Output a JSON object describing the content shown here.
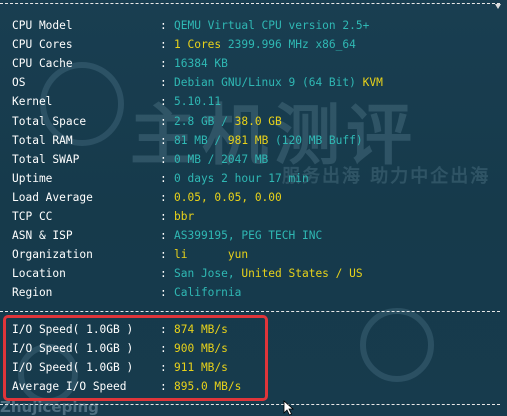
{
  "watermark": {
    "big_text": "主机测评",
    "small_text": "服务出海 助力中企出海",
    "bottom_text": "Zhujiceping"
  },
  "colors": {
    "background": "#173a4c",
    "label": "#ffffff",
    "value_cyan": "#2fb8b4",
    "value_yellow": "#e8d21a",
    "highlight_border": "#e0353a"
  },
  "rows": [
    {
      "label": "CPU Model",
      "parts": [
        {
          "text": "QEMU Virtual CPU version 2.5+",
          "color": "cyan"
        }
      ]
    },
    {
      "label": "CPU Cores",
      "parts": [
        {
          "text": "1 Cores ",
          "color": "yellow"
        },
        {
          "text": "2399.996 MHz x86_64",
          "color": "cyan"
        }
      ]
    },
    {
      "label": "CPU Cache",
      "parts": [
        {
          "text": "16384 KB",
          "color": "cyan"
        }
      ]
    },
    {
      "label": "OS",
      "parts": [
        {
          "text": "Debian GNU/Linux 9 (64 Bit) ",
          "color": "cyan"
        },
        {
          "text": "KVM",
          "color": "yellow"
        }
      ]
    },
    {
      "label": "Kernel",
      "parts": [
        {
          "text": "5.10.11",
          "color": "cyan"
        }
      ]
    },
    {
      "label": "Total Space",
      "parts": [
        {
          "text": "2.8 GB / ",
          "color": "cyan"
        },
        {
          "text": "38.0 GB",
          "color": "yellow"
        }
      ]
    },
    {
      "label": "Total RAM",
      "parts": [
        {
          "text": "81 MB / ",
          "color": "cyan"
        },
        {
          "text": "981 MB",
          "color": "yellow"
        },
        {
          "text": " (120 MB Buff)",
          "color": "cyan"
        }
      ]
    },
    {
      "label": "Total SWAP",
      "parts": [
        {
          "text": "0 MB / 2047 MB",
          "color": "cyan"
        }
      ]
    },
    {
      "label": "Uptime",
      "parts": [
        {
          "text": "0 days 2 hour 17 min",
          "color": "cyan"
        }
      ]
    },
    {
      "label": "Load Average",
      "parts": [
        {
          "text": "0.05, 0.05, 0.00",
          "color": "yellow"
        }
      ]
    },
    {
      "label": "TCP CC",
      "parts": [
        {
          "text": "bbr",
          "color": "yellow"
        }
      ]
    },
    {
      "label": "ASN & ISP",
      "parts": [
        {
          "text": "AS399195, PEG TECH INC",
          "color": "cyan"
        }
      ]
    },
    {
      "label": "Organization",
      "parts": [
        {
          "text": "li      yun",
          "color": "yellow"
        }
      ]
    },
    {
      "label": "Location",
      "parts": [
        {
          "text": "San Jose, ",
          "color": "cyan"
        },
        {
          "text": "United States / US",
          "color": "yellow"
        }
      ]
    },
    {
      "label": "Region",
      "parts": [
        {
          "text": "California",
          "color": "cyan"
        }
      ]
    }
  ],
  "io_rows": [
    {
      "label": "I/O Speed( 1.0GB )",
      "value": "874 MB/s"
    },
    {
      "label": "I/O Speed( 1.0GB )",
      "value": "900 MB/s"
    },
    {
      "label": "I/O Speed( 1.0GB )",
      "value": "911 MB/s"
    },
    {
      "label": "Average I/O Speed",
      "value": "895.0 MB/s"
    }
  ],
  "colon": ":"
}
